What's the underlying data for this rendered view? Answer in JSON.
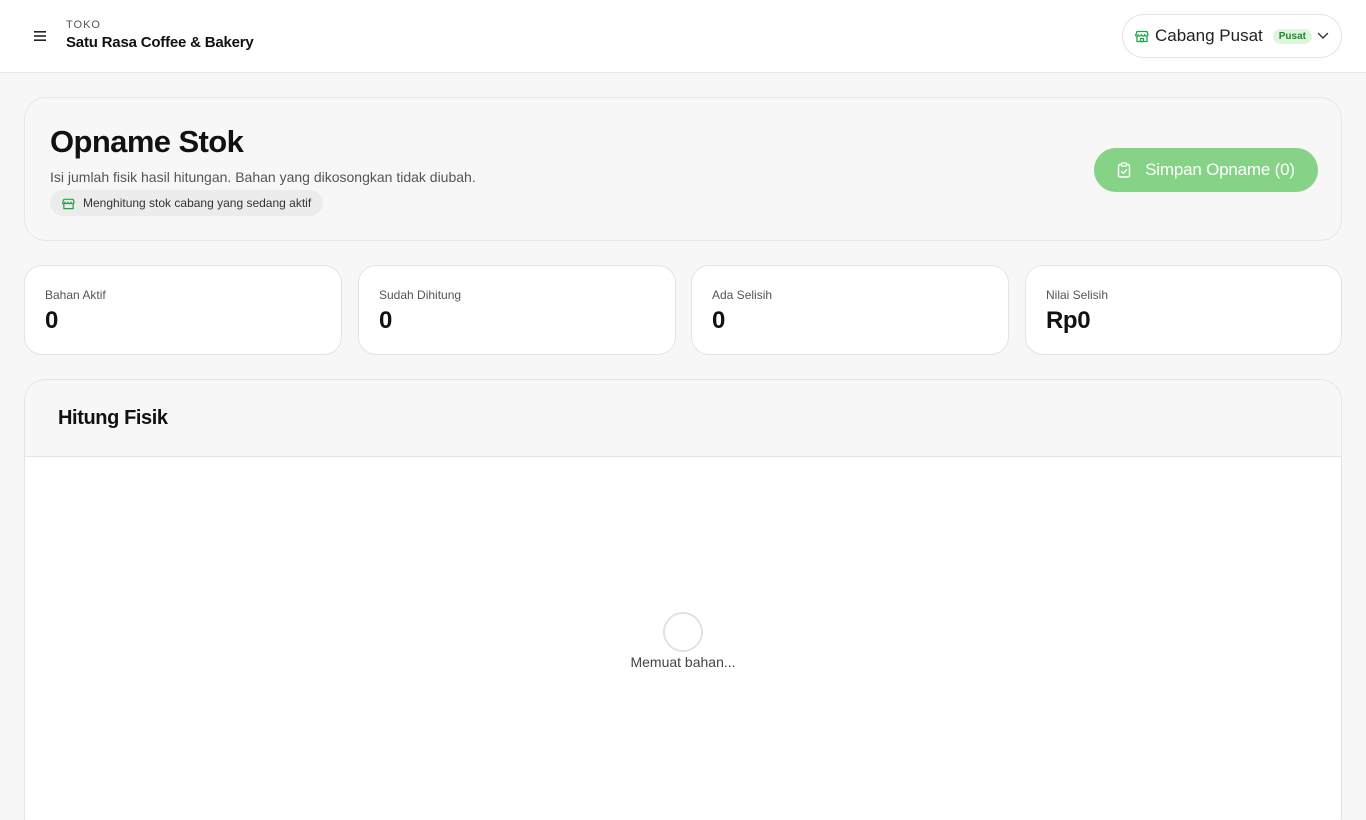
{
  "topbar": {
    "store_label": "TOKO",
    "store_name": "Satu Rasa Coffee & Bakery",
    "branch": {
      "name": "Cabang Pusat",
      "badge": "Pusat"
    }
  },
  "header": {
    "title": "Opname Stok",
    "subtitle": "Isi jumlah fisik hasil hitungan. Bahan yang dikosongkan tidak diubah.",
    "chip": "Menghitung stok cabang yang sedang aktif",
    "save_button": "Simpan Opname (0)"
  },
  "stats": [
    {
      "label": "Bahan Aktif",
      "value": "0"
    },
    {
      "label": "Sudah Dihitung",
      "value": "0"
    },
    {
      "label": "Ada Selisih",
      "value": "0"
    },
    {
      "label": "Nilai Selisih",
      "value": "Rp0"
    }
  ],
  "count_section": {
    "title": "Hitung Fisik",
    "loading_text": "Memuat bahan..."
  },
  "colors": {
    "accent_green": "#86d286",
    "badge_bg": "#dcf5dc",
    "badge_text": "#1e8a2e",
    "icon_green": "#22a34a"
  },
  "icons": {
    "menu": "hamburger-menu-icon",
    "branch": "store-icon",
    "dropdown": "chevron-down-icon",
    "save": "clipboard-icon"
  }
}
